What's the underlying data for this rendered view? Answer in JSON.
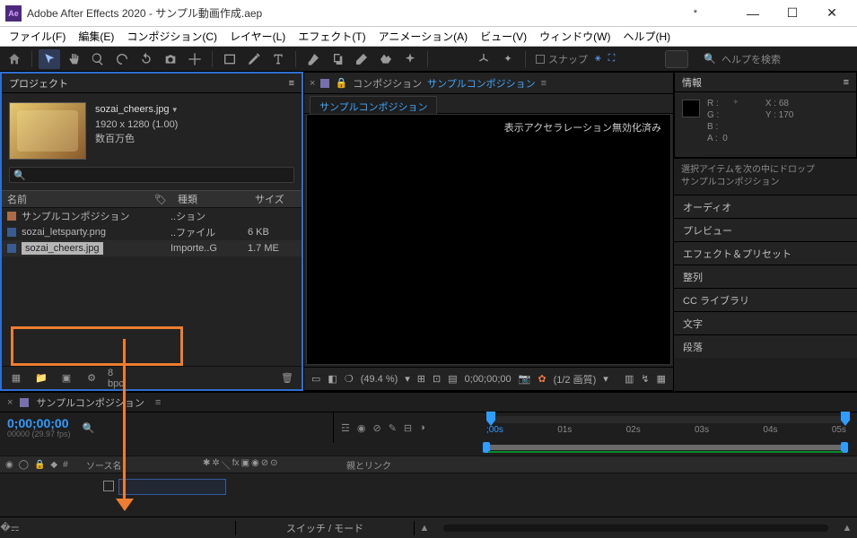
{
  "titlebar": {
    "app": "Adobe After Effects 2020",
    "project": "サンプル動画作成.aep",
    "dirty": "*"
  },
  "menu": [
    "ファイル(F)",
    "編集(E)",
    "コンポジション(C)",
    "レイヤー(L)",
    "エフェクト(T)",
    "アニメーション(A)",
    "ビュー(V)",
    "ウィンドウ(W)",
    "ヘルプ(H)"
  ],
  "toolbar": {
    "snap": "スナップ",
    "search_placeholder": "ヘルプを検索"
  },
  "project": {
    "tab": "プロジェクト",
    "preview": {
      "name": "sozai_cheers.jpg",
      "dims": "1920 x 1280 (1.00)",
      "colors": "数百万色"
    },
    "cols": {
      "name": "名前",
      "kind": "種類",
      "size": "サイズ"
    },
    "rows": [
      {
        "name": "サンプルコンポジション",
        "kind": "..ション",
        "size": ""
      },
      {
        "name": "sozai_letsparty.png",
        "kind": "..ファイル",
        "size": "6 KB"
      },
      {
        "name": "sozai_cheers.jpg",
        "kind": "Importe..G",
        "size": "1.7 ME"
      }
    ],
    "bpc": "8 bpc"
  },
  "comp": {
    "prefix": "コンポジション",
    "name": "サンプルコンポジション",
    "subtab": "サンプルコンポジション",
    "accel": "表示アクセラレーション無効化済み",
    "zoom": "(49.4 %)",
    "time": "0;00;00;00",
    "quality": "(1/2 画質)"
  },
  "info": {
    "tab": "情報",
    "R": "R :",
    "G": "G :",
    "B": "B :",
    "A": "A :",
    "A_val": "0",
    "X": "X :",
    "X_val": "68",
    "Y": "Y :",
    "Y_val": "170"
  },
  "drop_hint": {
    "l1": "選択アイテムを次の中にドロップ",
    "l2": "サンプルコンポジション"
  },
  "side": [
    "オーディオ",
    "プレビュー",
    "エフェクト＆プリセット",
    "整列",
    "CC ライブラリ",
    "文字",
    "段落"
  ],
  "timeline": {
    "tab": "サンプルコンポジション",
    "timecode": "0;00;00;00",
    "timecode_sub": "00000 (29.97 fps)",
    "ticks": [
      ";00s",
      "01s",
      "02s",
      "03s",
      "04s",
      "05s"
    ],
    "col_src": "ソース名",
    "col_parent": "親とリンク",
    "switches": "スイッチ / モード"
  }
}
